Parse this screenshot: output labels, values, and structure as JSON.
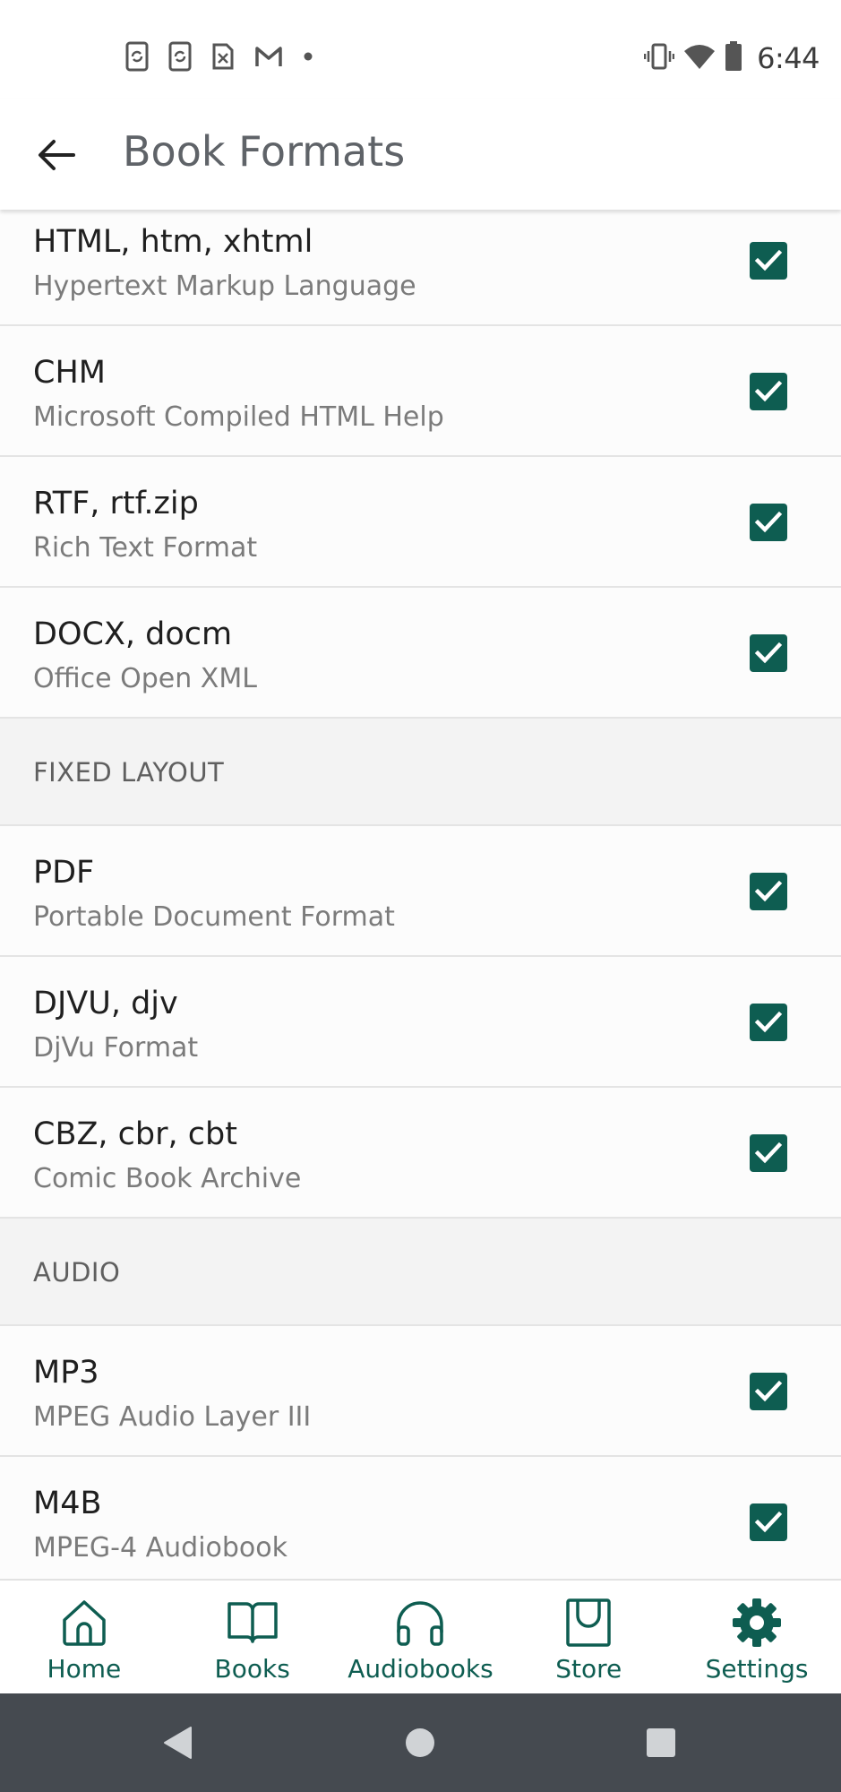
{
  "status_bar": {
    "time": "6:44",
    "left_icons": [
      "phone-sync-icon",
      "phone-sync-icon",
      "sim-off-icon",
      "gmail-icon",
      "dot-icon"
    ],
    "right_icons": [
      "vibrate-icon",
      "wifi-icon",
      "battery-icon"
    ]
  },
  "app_bar": {
    "title": "Book Formats",
    "back_icon": "arrow-left-icon"
  },
  "list": [
    {
      "kind": "item",
      "title": "HTML, htm, xhtml",
      "subtitle": "Hypertext Markup Language",
      "checked": true
    },
    {
      "kind": "item",
      "title": "CHM",
      "subtitle": "Microsoft Compiled HTML Help",
      "checked": true
    },
    {
      "kind": "item",
      "title": "RTF, rtf.zip",
      "subtitle": "Rich Text Format",
      "checked": true
    },
    {
      "kind": "item",
      "title": "DOCX, docm",
      "subtitle": "Office Open XML",
      "checked": true
    },
    {
      "kind": "section",
      "label": "FIXED LAYOUT"
    },
    {
      "kind": "item",
      "title": "PDF",
      "subtitle": "Portable Document Format",
      "checked": true
    },
    {
      "kind": "item",
      "title": "DJVU, djv",
      "subtitle": "DjVu Format",
      "checked": true
    },
    {
      "kind": "item",
      "title": "CBZ, cbr, cbt",
      "subtitle": "Comic Book Archive",
      "checked": true
    },
    {
      "kind": "section",
      "label": "AUDIO"
    },
    {
      "kind": "item",
      "title": "MP3",
      "subtitle": "MPEG Audio Layer III",
      "checked": true
    },
    {
      "kind": "item",
      "title": "M4B",
      "subtitle": "MPEG-4 Audiobook",
      "checked": true
    }
  ],
  "bottom_nav": [
    {
      "label": "Home",
      "icon": "home-icon"
    },
    {
      "label": "Books",
      "icon": "book-icon"
    },
    {
      "label": "Audiobooks",
      "icon": "headphones-icon"
    },
    {
      "label": "Store",
      "icon": "store-icon"
    },
    {
      "label": "Settings",
      "icon": "gear-icon",
      "active": true
    }
  ],
  "system_nav": [
    "back-triangle-icon",
    "home-circle-icon",
    "recents-square-icon"
  ],
  "colors": {
    "accent": "#0e5d51",
    "section_bg": "#f3f3f3",
    "system_nav_bg": "#454a50"
  }
}
